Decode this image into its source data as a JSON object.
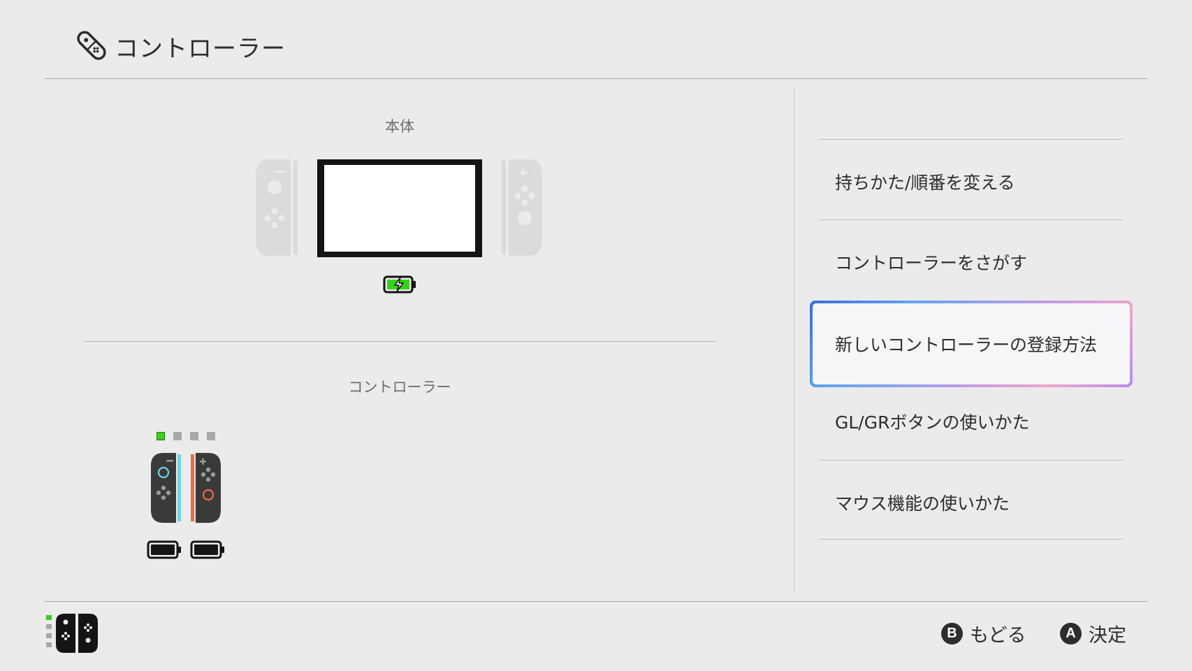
{
  "header": {
    "title": "コントローラー",
    "icon": "joycon-controller-icon"
  },
  "console_section": {
    "label": "本体",
    "battery_state": "charging",
    "battery_color": "#35d11b"
  },
  "controllers_section": {
    "label": "コントローラー",
    "player_lights": [
      true,
      false,
      false,
      false
    ],
    "left_joycon_color": "#6fd3e8",
    "right_joycon_color": "#f06b3f",
    "batteries": [
      "full",
      "full"
    ]
  },
  "menu": {
    "items": [
      {
        "label": "持ちかた/順番を変える",
        "selected": false
      },
      {
        "label": "コントローラーをさがす",
        "selected": false
      },
      {
        "label": "新しいコントローラーの登録方法",
        "selected": true
      },
      {
        "label": "GL/GRボタンの使いかた",
        "selected": false
      },
      {
        "label": "マウス機能の使いかた",
        "selected": false
      }
    ]
  },
  "footer": {
    "back": {
      "key": "B",
      "label": "もどる"
    },
    "ok": {
      "key": "A",
      "label": "決定"
    },
    "accent": "#35d11b"
  }
}
